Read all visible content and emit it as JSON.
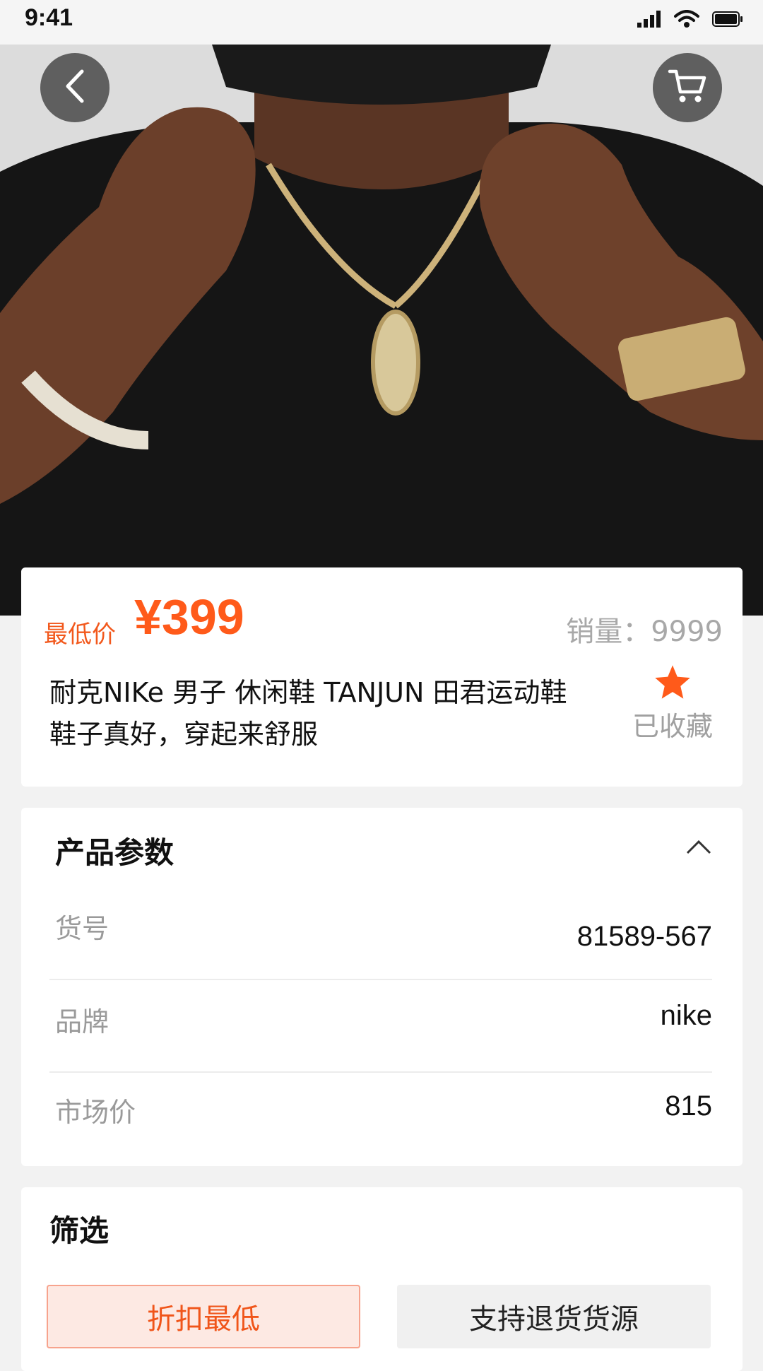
{
  "status_bar": {
    "time": "9:41"
  },
  "product": {
    "price_label": "最低价",
    "price": "¥399",
    "sales_text": "销量：9999",
    "title": "耐克NIKe 男子 休闲鞋 TANJUN 田君运动鞋 鞋子真好，穿起来舒服",
    "favorite_label": "已收藏"
  },
  "params": {
    "title": "产品参数",
    "rows": [
      {
        "label": "货号",
        "value": "81589-567"
      },
      {
        "label": "品牌",
        "value": "nike"
      },
      {
        "label": "市场价",
        "value": "815"
      }
    ]
  },
  "filter": {
    "title": "筛选",
    "options": [
      {
        "label": "折扣最低",
        "selected": true
      },
      {
        "label": "支持退货货源",
        "selected": false
      }
    ]
  },
  "colors": {
    "accent": "#ff5a1a",
    "accent_bg": "#fde9e3"
  },
  "icons": [
    "back-icon",
    "cart-icon",
    "star-icon",
    "chevron-up-icon",
    "signal-icon",
    "wifi-icon",
    "battery-icon"
  ]
}
